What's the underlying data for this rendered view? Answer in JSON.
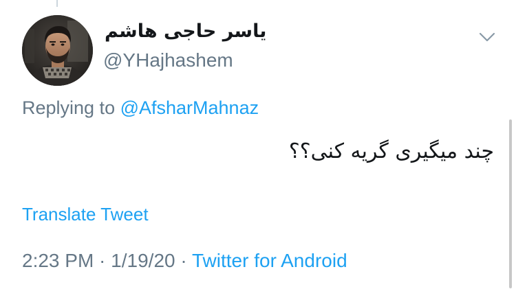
{
  "tweet": {
    "display_name": "یاسر حاجی هاشم",
    "handle": "@YHajhashem",
    "reply_prefix": "Replying to ",
    "reply_to": "@AfsharMahnaz",
    "text": "چند میگیری گریه کنی؟؟",
    "translate_label": "Translate Tweet",
    "time": "2:23 PM",
    "separator": " · ",
    "date": "1/19/20",
    "source": "Twitter for Android"
  },
  "icons": {
    "menu": "chevron-down-icon",
    "avatar": "profile-photo"
  },
  "colors": {
    "link": "#1da1f2",
    "secondary_text": "#657786",
    "primary_text": "#14171a",
    "background": "#ffffff"
  }
}
